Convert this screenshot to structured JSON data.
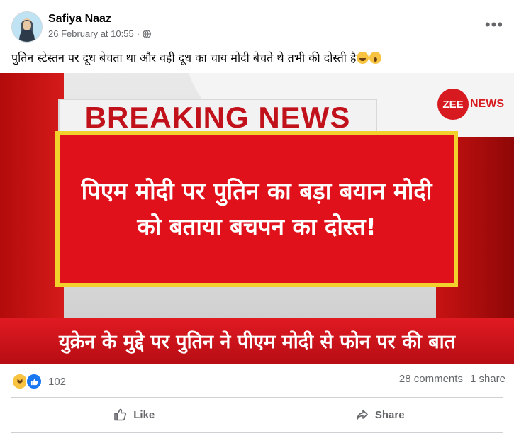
{
  "post": {
    "author": "Safiya Naaz",
    "date": "26 February at 10:55",
    "separator": "·",
    "text": "पुतिन स्टेस्तन पर दूध बेचता था और वही दूध का चाय मोदी बेचते थे तभी की दोस्ती है",
    "more_icon": "•••"
  },
  "image": {
    "logo_zee": "ZEE",
    "logo_news": "NEWS",
    "breaking": "BREAKING NEWS",
    "headline": "पिएम मोदी पर पुतिन का बड़ा बयान मोदी को बताया बचपन का दोस्त!",
    "ticker": "युक्रेन के मुद्दे पर पुतिन ने पीएम मोदी से फोन पर की बात"
  },
  "stats": {
    "reaction_count": "102",
    "comments": "28 comments",
    "shares": "1 share"
  },
  "actions": {
    "like": "Like",
    "share": "Share"
  },
  "colors": {
    "accent": "#1877f2",
    "zee_red": "#d71920",
    "headline_red": "#e0111a",
    "border_yellow": "#f3d12c"
  }
}
